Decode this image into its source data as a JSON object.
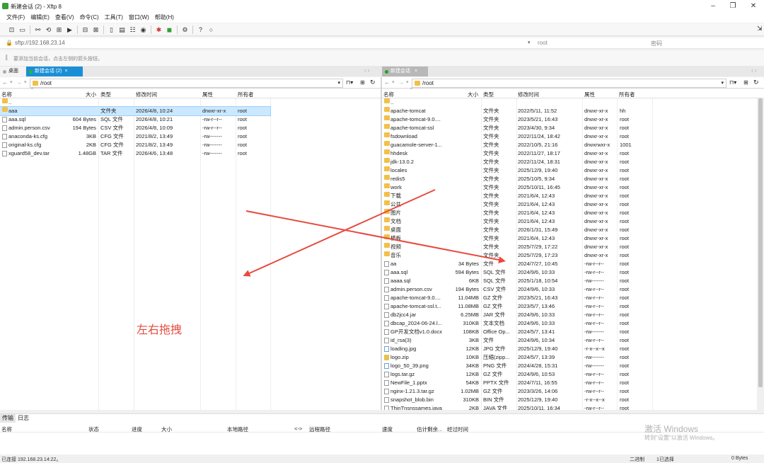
{
  "window": {
    "title": "新建会话 (2) - Xftp 8"
  },
  "menu": [
    "文件(F)",
    "编辑(E)",
    "查看(V)",
    "命令(C)",
    "工具(T)",
    "窗口(W)",
    "帮助(H)"
  ],
  "address": {
    "value": "sftp://192.168.23.14",
    "user_placeholder": "root",
    "pass_placeholder": "密码"
  },
  "hint": "要添加当前会话，点击左侧的箭头按钮。",
  "tabs": {
    "desktop": "桌面",
    "left_session": "新建会话 (2)",
    "right_session": "新建会话"
  },
  "colors": {
    "accent": "#1a8fd6",
    "session_green": "#22a022",
    "annotation": "#e84a3f"
  },
  "left": {
    "path": "/root",
    "headers": {
      "name": "名称",
      "size": "大小",
      "type": "类型",
      "mtime": "修改时间",
      "perm": "属性",
      "owner": "所有者"
    },
    "rows": [
      {
        "icon": "up",
        "name": "..",
        "size": "",
        "type": "",
        "mtime": "",
        "perm": "",
        "owner": ""
      },
      {
        "icon": "folder",
        "name": "aaa",
        "size": "",
        "type": "文件夹",
        "mtime": "2026/4/8, 10:24",
        "perm": "drwxr-xr-x",
        "owner": "root",
        "selected": true
      },
      {
        "icon": "file",
        "name": "aaa.sql",
        "size": "604 Bytes",
        "type": "SQL 文件",
        "mtime": "2026/4/8, 10:21",
        "perm": "-rw-r--r--",
        "owner": "root"
      },
      {
        "icon": "file",
        "name": "admin.person.csv",
        "size": "194 Bytes",
        "type": "CSV 文件",
        "mtime": "2026/4/8, 10:09",
        "perm": "-rw-r--r--",
        "owner": "root"
      },
      {
        "icon": "file",
        "name": "anaconda-ks.cfg",
        "size": "3KB",
        "type": "CFG 文件",
        "mtime": "2021/8/2, 13:49",
        "perm": "-rw-------",
        "owner": "root"
      },
      {
        "icon": "file",
        "name": "original-ks.cfg",
        "size": "2KB",
        "type": "CFG 文件",
        "mtime": "2021/8/2, 13:49",
        "perm": "-rw-------",
        "owner": "root"
      },
      {
        "icon": "file",
        "name": "xguard58_dev.tar",
        "size": "1.48GB",
        "type": "TAR 文件",
        "mtime": "2026/4/6, 13:48",
        "perm": "-rw-------",
        "owner": "root"
      }
    ]
  },
  "right": {
    "path": "/root",
    "headers": {
      "name": "名称",
      "size": "大小",
      "type": "类型",
      "mtime": "修改时间",
      "perm": "属性",
      "owner": "所有者"
    },
    "rows": [
      {
        "icon": "up",
        "name": "..",
        "size": "",
        "type": "",
        "mtime": "",
        "perm": "",
        "owner": ""
      },
      {
        "icon": "folder",
        "name": "apache-tomcat",
        "size": "",
        "type": "文件夹",
        "mtime": "2022/5/11, 11:52",
        "perm": "drwxr-xr-x",
        "owner": "hh"
      },
      {
        "icon": "folder",
        "name": "apache-tomcat-9.0....",
        "size": "",
        "type": "文件夹",
        "mtime": "2023/5/21, 16:43",
        "perm": "drwxr-xr-x",
        "owner": "root"
      },
      {
        "icon": "folder",
        "name": "apache-tomcat-ssl",
        "size": "",
        "type": "文件夹",
        "mtime": "2023/4/30, 9:34",
        "perm": "drwxr-xr-x",
        "owner": "root"
      },
      {
        "icon": "folder",
        "name": "fsdownload",
        "size": "",
        "type": "文件夹",
        "mtime": "2022/11/24, 18:42",
        "perm": "drwxr-xr-x",
        "owner": "root"
      },
      {
        "icon": "folder",
        "name": "guacamole-server-1...",
        "size": "",
        "type": "文件夹",
        "mtime": "2022/10/5, 21:16",
        "perm": "drwxrwxr-x",
        "owner": "1001"
      },
      {
        "icon": "folder",
        "name": "hhdesk",
        "size": "",
        "type": "文件夹",
        "mtime": "2022/11/27, 18:17",
        "perm": "drwxr-xr-x",
        "owner": "root"
      },
      {
        "icon": "folder",
        "name": "jdk-13.0.2",
        "size": "",
        "type": "文件夹",
        "mtime": "2022/11/24, 18:31",
        "perm": "drwxr-xr-x",
        "owner": "root"
      },
      {
        "icon": "folder",
        "name": "locales",
        "size": "",
        "type": "文件夹",
        "mtime": "2025/12/9, 19:40",
        "perm": "drwxr-xr-x",
        "owner": "root"
      },
      {
        "icon": "folder",
        "name": "redis5",
        "size": "",
        "type": "文件夹",
        "mtime": "2025/10/5, 9:34",
        "perm": "drwxr-xr-x",
        "owner": "root"
      },
      {
        "icon": "folder",
        "name": "work",
        "size": "",
        "type": "文件夹",
        "mtime": "2025/10/11, 16:45",
        "perm": "drwxr-xr-x",
        "owner": "root"
      },
      {
        "icon": "folder",
        "name": "下载",
        "size": "",
        "type": "文件夹",
        "mtime": "2021/6/4, 12:43",
        "perm": "drwxr-xr-x",
        "owner": "root"
      },
      {
        "icon": "folder",
        "name": "公共",
        "size": "",
        "type": "文件夹",
        "mtime": "2021/6/4, 12:43",
        "perm": "drwxr-xr-x",
        "owner": "root"
      },
      {
        "icon": "folder",
        "name": "图片",
        "size": "",
        "type": "文件夹",
        "mtime": "2021/6/4, 12:43",
        "perm": "drwxr-xr-x",
        "owner": "root"
      },
      {
        "icon": "folder",
        "name": "文档",
        "size": "",
        "type": "文件夹",
        "mtime": "2021/6/4, 12:43",
        "perm": "drwxr-xr-x",
        "owner": "root"
      },
      {
        "icon": "folder",
        "name": "桌面",
        "size": "",
        "type": "文件夹",
        "mtime": "2026/1/31, 15:49",
        "perm": "drwxr-xr-x",
        "owner": "root"
      },
      {
        "icon": "folder",
        "name": "模板",
        "size": "",
        "type": "文件夹",
        "mtime": "2021/6/4, 12:43",
        "perm": "drwxr-xr-x",
        "owner": "root"
      },
      {
        "icon": "folder",
        "name": "视频",
        "size": "",
        "type": "文件夹",
        "mtime": "2025/7/29, 17:22",
        "perm": "drwxr-xr-x",
        "owner": "root"
      },
      {
        "icon": "folder",
        "name": "音乐",
        "size": "",
        "type": "文件夹",
        "mtime": "2025/7/29, 17:23",
        "perm": "drwxr-xr-x",
        "owner": "root"
      },
      {
        "icon": "file",
        "name": "aa",
        "size": "34 Bytes",
        "type": "文件",
        "mtime": "2024/7/27, 10:45",
        "perm": "-rw-r--r--",
        "owner": "root"
      },
      {
        "icon": "file",
        "name": "aaa.sql",
        "size": "594 Bytes",
        "type": "SQL 文件",
        "mtime": "2024/9/6, 10:33",
        "perm": "-rw-r--r--",
        "owner": "root"
      },
      {
        "icon": "file",
        "name": "aaaa.sql",
        "size": "6KB",
        "type": "SQL 文件",
        "mtime": "2025/1/18, 10:54",
        "perm": "-rw-------",
        "owner": "root"
      },
      {
        "icon": "file",
        "name": "admin.person.csv",
        "size": "194 Bytes",
        "type": "CSV 文件",
        "mtime": "2024/9/6, 10:33",
        "perm": "-rw-r--r--",
        "owner": "root"
      },
      {
        "icon": "file",
        "name": "apache-tomcat-9.0....",
        "size": "11.04MB",
        "type": "GZ 文件",
        "mtime": "2023/5/21, 16:43",
        "perm": "-rw-r--r--",
        "owner": "root"
      },
      {
        "icon": "file",
        "name": "apache-tomcat-ssl.t...",
        "size": "11.08MB",
        "type": "GZ 文件",
        "mtime": "2023/5/7, 13:46",
        "perm": "-rw-r--r--",
        "owner": "root"
      },
      {
        "icon": "file",
        "name": "db2jcc4.jar",
        "size": "6.25MB",
        "type": "JAR 文件",
        "mtime": "2024/9/6, 10:33",
        "perm": "-rw-r--r--",
        "owner": "root"
      },
      {
        "icon": "file",
        "name": "dbcap_2024-06-24.l...",
        "size": "310KB",
        "type": "文本文档",
        "mtime": "2024/9/6, 10:33",
        "perm": "-rw-r--r--",
        "owner": "root"
      },
      {
        "icon": "file",
        "name": "GP开发文档v1.0.docx",
        "size": "108KB",
        "type": "Office Op...",
        "mtime": "2024/5/7, 13:41",
        "perm": "-rw-------",
        "owner": "root"
      },
      {
        "icon": "file",
        "name": "id_rsa(3)",
        "size": "3KB",
        "type": "文件",
        "mtime": "2024/9/6, 10:34",
        "perm": "-rw-r--r--",
        "owner": "root"
      },
      {
        "icon": "img",
        "name": "loading.jpg",
        "size": "12KB",
        "type": "JPG 文件",
        "mtime": "2025/12/9, 19:40",
        "perm": "-r-x--x--x",
        "owner": "root"
      },
      {
        "icon": "zip",
        "name": "logo.zip",
        "size": "10KB",
        "type": "压缩(zipp...",
        "mtime": "2024/5/7, 13:39",
        "perm": "-rw-------",
        "owner": "root"
      },
      {
        "icon": "img",
        "name": "logo_50_39.png",
        "size": "34KB",
        "type": "PNG 文件",
        "mtime": "2024/4/28, 15:31",
        "perm": "-rw-------",
        "owner": "root"
      },
      {
        "icon": "file",
        "name": "logs.tar.gz",
        "size": "12KB",
        "type": "GZ 文件",
        "mtime": "2024/9/6, 10:53",
        "perm": "-rw-r--r--",
        "owner": "root"
      },
      {
        "icon": "file",
        "name": "NewFile_1.pptx",
        "size": "54KB",
        "type": "PPTX 文件",
        "mtime": "2024/7/11, 16:55",
        "perm": "-rw-r--r--",
        "owner": "root"
      },
      {
        "icon": "file",
        "name": "nginx-1.21.3.tar.gz",
        "size": "1.02MB",
        "type": "GZ 文件",
        "mtime": "2023/3/26, 14:06",
        "perm": "-rw-r--r--",
        "owner": "root"
      },
      {
        "icon": "file",
        "name": "snapshot_blob.bin",
        "size": "310KB",
        "type": "BIN 文件",
        "mtime": "2025/12/9, 19:40",
        "perm": "-r-x--x--x",
        "owner": "root"
      },
      {
        "icon": "file",
        "name": "ThinTnsnssames.java",
        "size": "2KB",
        "type": "JAVA 文件",
        "mtime": "2025/10/11, 16:34",
        "perm": "-rw-r--r--",
        "owner": "root"
      }
    ]
  },
  "annotation": {
    "text": "左右拖拽"
  },
  "transfer": {
    "tabs": [
      "传输",
      "日志"
    ],
    "headers": [
      "名称",
      "状态",
      "进度",
      "大小",
      "本地路径",
      "<->",
      "远程路径",
      "速度",
      "估计剩余...",
      "经过时间"
    ]
  },
  "watermark": {
    "line1": "激活 Windows",
    "line2": "转到\"设置\"以激活 Windows。"
  },
  "status": {
    "left": "已连接 192.168.23.14:22。",
    "mode": "二进制",
    "selected": "1已选择",
    "size": "0 Bytes"
  }
}
